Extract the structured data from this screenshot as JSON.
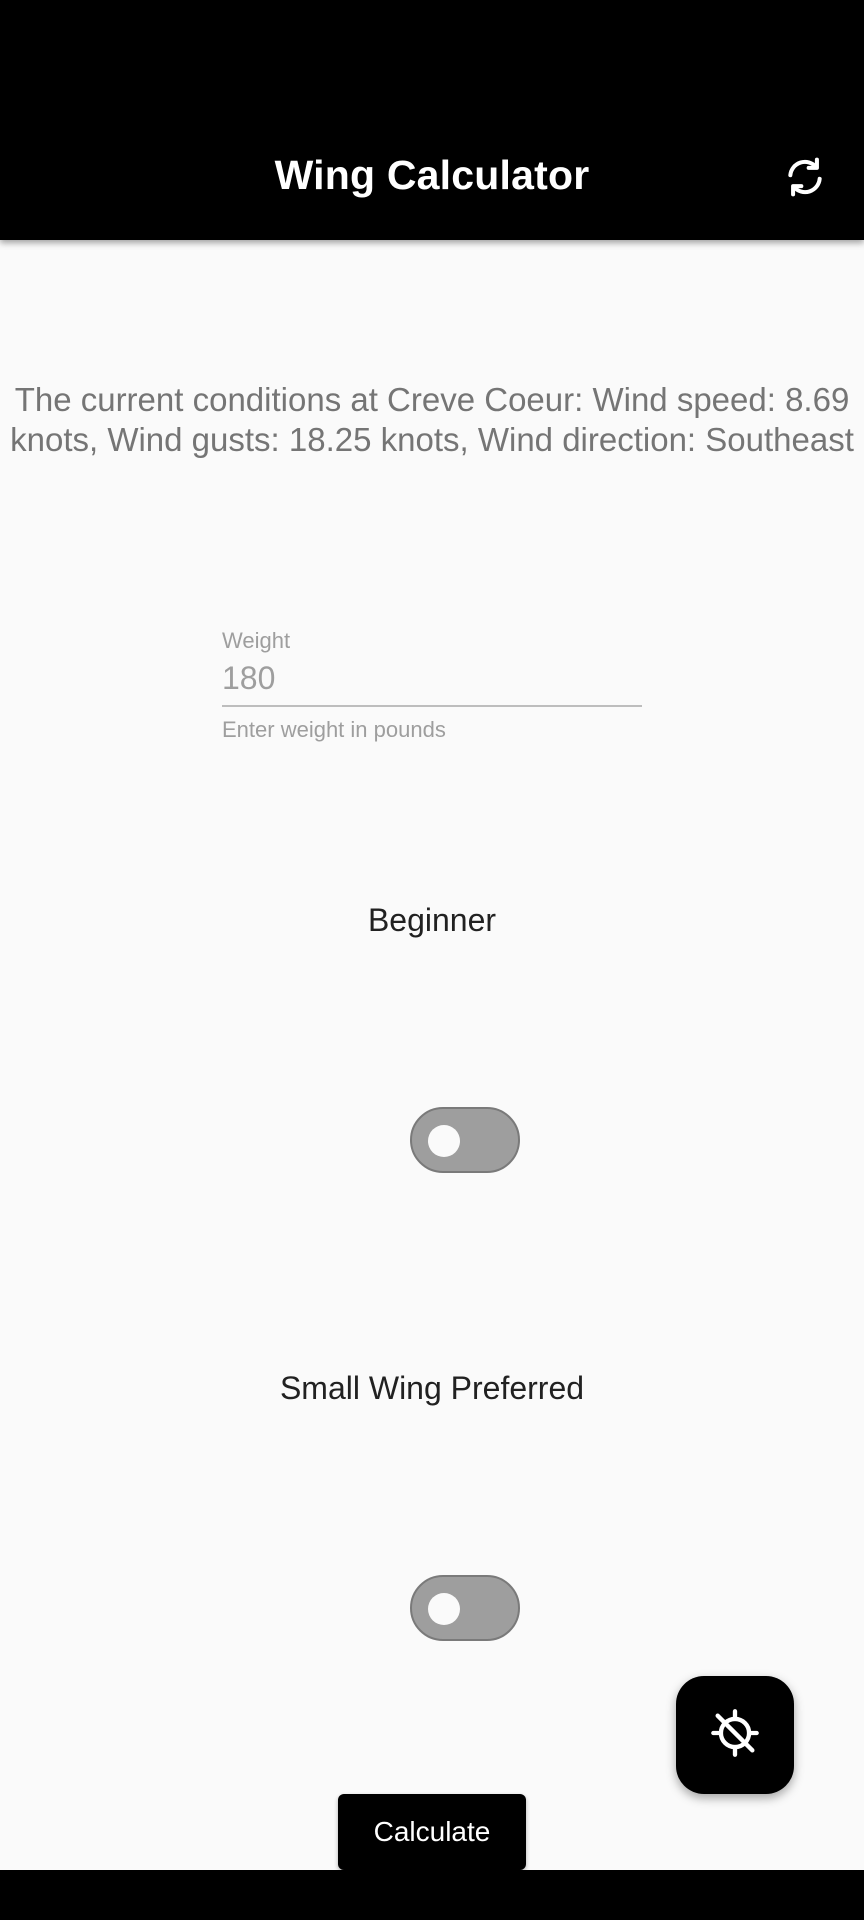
{
  "app_bar": {
    "title": "Wing Calculator",
    "refresh_icon": "refresh-icon"
  },
  "conditions": {
    "text": "The current conditions at Creve Coeur: Wind speed: 8.69 knots, Wind gusts: 18.25 knots, Wind direction: Southeast"
  },
  "weight": {
    "label": "Weight",
    "value": "180",
    "helper": "Enter weight in pounds"
  },
  "beginner": {
    "label": "Beginner",
    "enabled": false
  },
  "small_wing": {
    "label": "Small Wing Preferred",
    "enabled": false
  },
  "fab": {
    "icon": "location-disabled-icon"
  },
  "calculate": {
    "label": "Calculate"
  },
  "colors": {
    "app_bar": "#000000",
    "background": "#fafafa",
    "toggle_off": "#9e9e9e"
  }
}
